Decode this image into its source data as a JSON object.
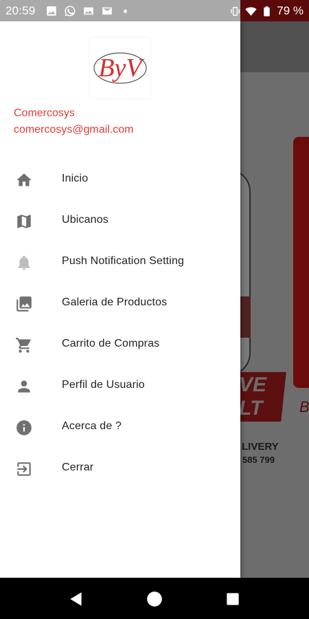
{
  "status_bar": {
    "time": "20:59",
    "battery": "79 %",
    "icons": [
      "image-icon",
      "whatsapp-icon",
      "picture-icon",
      "mail-icon",
      "dot-icon",
      "vibrate-icon",
      "wifi-icon",
      "battery-icon"
    ]
  },
  "drawer": {
    "logo_text": "ByV",
    "user_name": "Comercosys",
    "user_email": "comercosys@gmail.com",
    "menu": [
      {
        "label": "Inicio",
        "icon": "home-icon"
      },
      {
        "label": "Ubicanos",
        "icon": "map-icon"
      },
      {
        "label": "Push Notification Setting",
        "icon": "bell-icon"
      },
      {
        "label": "Galeria de Productos",
        "icon": "gallery-icon"
      },
      {
        "label": "Carrito de Compras",
        "icon": "cart-icon"
      },
      {
        "label": "Perfil de Usuario",
        "icon": "person-icon"
      },
      {
        "label": "Acerca de ?",
        "icon": "info-icon"
      },
      {
        "label": "Cerrar",
        "icon": "exit-icon"
      }
    ]
  },
  "background": {
    "banner_text": "VE\nLT",
    "delivery": "LIVERY",
    "phone": "585 799",
    "side_letter": "B"
  },
  "colors": {
    "accent": "#e53935",
    "icon": "#707070",
    "text": "#212121"
  }
}
